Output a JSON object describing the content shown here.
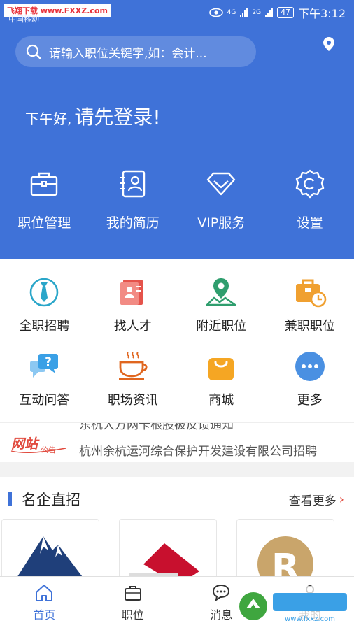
{
  "status_bar": {
    "watermark": "飞翔下载 www.FXXZ.com",
    "carrier": "中国移动",
    "signal_1": "4G",
    "signal_2": "2G",
    "battery": "47",
    "time": "下午3:12"
  },
  "search": {
    "placeholder": "请输入职位关键字,如：会计..."
  },
  "greeting": {
    "prefix": "下午好,",
    "main": "请先登录!"
  },
  "quick_actions": [
    {
      "label": "职位管理",
      "icon": "briefcase-icon"
    },
    {
      "label": "我的简历",
      "icon": "resume-icon"
    },
    {
      "label": "VIP服务",
      "icon": "vip-diamond-icon"
    },
    {
      "label": "设置",
      "icon": "gear-icon"
    }
  ],
  "grid": [
    {
      "label": "全职招聘",
      "icon": "tie-icon",
      "color": "#2aa6c9"
    },
    {
      "label": "找人才",
      "icon": "id-card-icon",
      "color": "#e5534b"
    },
    {
      "label": "附近职位",
      "icon": "map-pin-icon",
      "color": "#2f9e6e"
    },
    {
      "label": "兼职职位",
      "icon": "clock-briefcase-icon",
      "color": "#f0a030"
    },
    {
      "label": "互动问答",
      "icon": "chat-question-icon",
      "color": "#3aa0e6"
    },
    {
      "label": "职场资讯",
      "icon": "coffee-cup-icon",
      "color": "#e0661f"
    },
    {
      "label": "商城",
      "icon": "shopping-bag-icon",
      "color": "#f5a623"
    },
    {
      "label": "更多",
      "icon": "more-dots-icon",
      "color": "#4a90e2"
    }
  ],
  "notice": {
    "logo_text": "网站",
    "logo_sub": "公告",
    "line1": "东杭大方网卡根股被反馈通知",
    "line2": "杭州余杭运河综合保护开发建设有限公司招聘"
  },
  "section": {
    "title": "名企直招",
    "more": "查看更多",
    "chevron": "›"
  },
  "tabs": [
    {
      "label": "首页",
      "icon": "home-icon",
      "active": true
    },
    {
      "label": "职位",
      "icon": "briefcase-icon",
      "active": false
    },
    {
      "label": "消息",
      "icon": "chat-bubble-icon",
      "active": false
    },
    {
      "label": "我的",
      "icon": "person-icon",
      "active": false
    }
  ],
  "colors": {
    "primary": "#3f72d8",
    "accent_red": "#e14b3f"
  }
}
